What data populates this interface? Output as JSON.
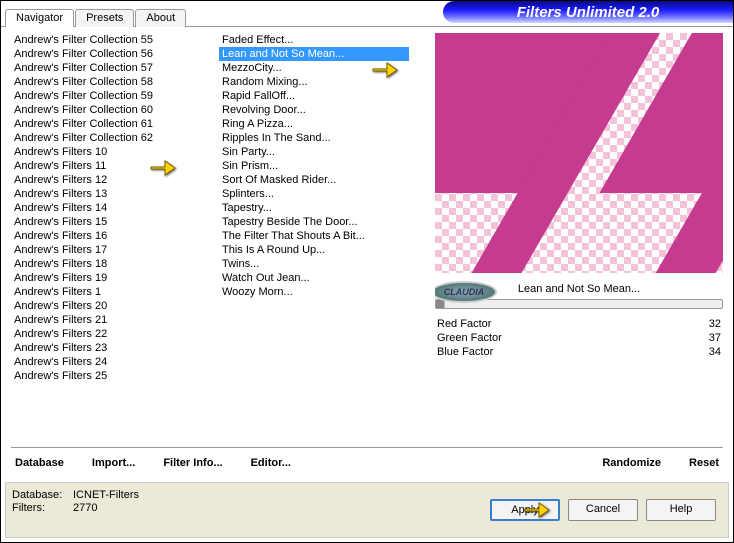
{
  "header": {
    "title": "Filters Unlimited 2.0"
  },
  "tabs": [
    {
      "label": "Navigator"
    },
    {
      "label": "Presets"
    },
    {
      "label": "About"
    }
  ],
  "col1": {
    "items": [
      "Andrew's Filter Collection 55",
      "Andrew's Filter Collection 56",
      "Andrew's Filter Collection 57",
      "Andrew's Filter Collection 58",
      "Andrew's Filter Collection 59",
      "Andrew's Filter Collection 60",
      "Andrew's Filter Collection 61",
      "Andrew's Filter Collection 62",
      "Andrew's Filters 10",
      "Andrew's Filters 11",
      "Andrew's Filters 12",
      "Andrew's Filters 13",
      "Andrew's Filters 14",
      "Andrew's Filters 15",
      "Andrew's Filters 16",
      "Andrew's Filters 17",
      "Andrew's Filters 18",
      "Andrew's Filters 19",
      "Andrew's Filters 1",
      "Andrew's Filters 20",
      "Andrew's Filters 21",
      "Andrew's Filters 22",
      "Andrew's Filters 23",
      "Andrew's Filters 24",
      "Andrew's Filters 25"
    ]
  },
  "col2": {
    "items": [
      "Faded Effect...",
      "Lean and Not So Mean...",
      "MezzoCity...",
      "Random Mixing...",
      "Rapid FallOff...",
      "Revolving Door...",
      "Ring A Pizza...",
      "Ripples In The Sand...",
      "Sin Party...",
      "Sin Prism...",
      "Sort Of Masked Rider...",
      "Splinters...",
      "Tapestry...",
      "Tapestry Beside The Door...",
      "The Filter That Shouts A Bit...",
      "This Is A Round Up...",
      "Twins...",
      "Watch Out Jean...",
      "Woozy Morn..."
    ],
    "selected": 1
  },
  "preview": {
    "label": "Lean and Not So Mean..."
  },
  "params": [
    {
      "name": "Red Factor",
      "value": "32"
    },
    {
      "name": "Green Factor",
      "value": "37"
    },
    {
      "name": "Blue Factor",
      "value": "34"
    }
  ],
  "links": {
    "database": "Database",
    "import": "Import...",
    "filterinfo": "Filter Info...",
    "editor": "Editor...",
    "randomize": "Randomize",
    "reset": "Reset"
  },
  "footer": {
    "db_label": "Database:",
    "db_val": "ICNET-Filters",
    "filters_label": "Filters:",
    "filters_val": "2770"
  },
  "buttons": {
    "apply": "Apply",
    "cancel": "Cancel",
    "help": "Help"
  },
  "badge": "CLAUDIA"
}
